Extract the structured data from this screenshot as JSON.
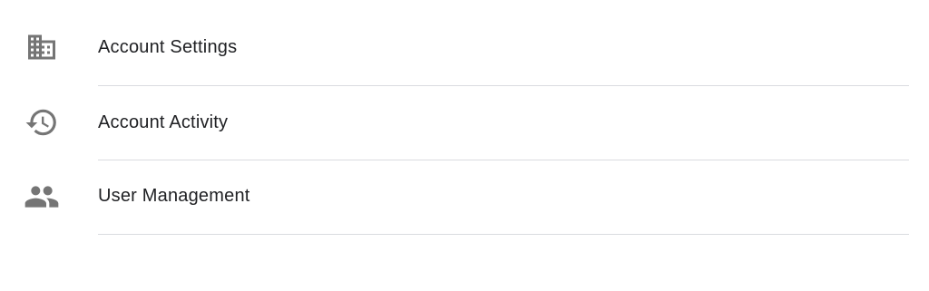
{
  "menu": {
    "items": [
      {
        "label": "Account Settings",
        "icon": "building-icon"
      },
      {
        "label": "Account Activity",
        "icon": "history-icon"
      },
      {
        "label": "User Management",
        "icon": "people-icon"
      }
    ]
  },
  "colors": {
    "icon": "#757575",
    "text": "#202124",
    "divider": "#dadce0",
    "background": "#ffffff"
  }
}
